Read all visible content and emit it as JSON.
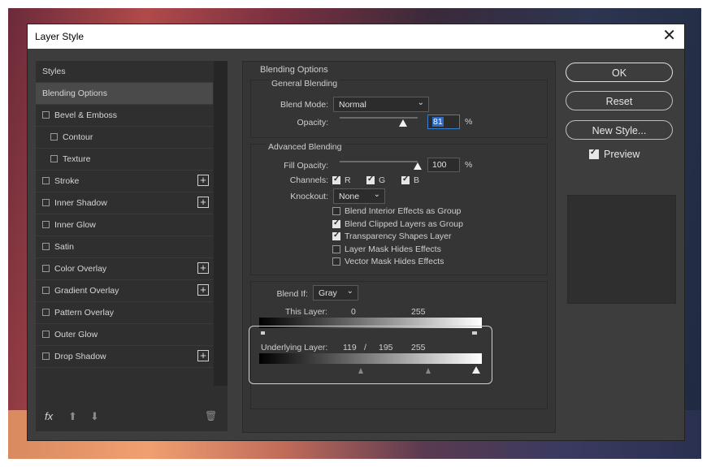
{
  "window": {
    "title": "Layer Style",
    "close_glyph": "✕"
  },
  "sidebar": {
    "items": [
      {
        "label": "Styles",
        "checkbox": false,
        "plus": false,
        "indent": 0,
        "active": false
      },
      {
        "label": "Blending Options",
        "checkbox": false,
        "plus": false,
        "indent": 0,
        "active": true
      },
      {
        "label": "Bevel & Emboss",
        "checkbox": true,
        "plus": false,
        "indent": 0
      },
      {
        "label": "Contour",
        "checkbox": true,
        "plus": false,
        "indent": 1
      },
      {
        "label": "Texture",
        "checkbox": true,
        "plus": false,
        "indent": 1
      },
      {
        "label": "Stroke",
        "checkbox": true,
        "plus": true,
        "indent": 0
      },
      {
        "label": "Inner Shadow",
        "checkbox": true,
        "plus": true,
        "indent": 0
      },
      {
        "label": "Inner Glow",
        "checkbox": true,
        "plus": false,
        "indent": 0
      },
      {
        "label": "Satin",
        "checkbox": true,
        "plus": false,
        "indent": 0
      },
      {
        "label": "Color Overlay",
        "checkbox": true,
        "plus": true,
        "indent": 0
      },
      {
        "label": "Gradient Overlay",
        "checkbox": true,
        "plus": true,
        "indent": 0
      },
      {
        "label": "Pattern Overlay",
        "checkbox": true,
        "plus": false,
        "indent": 0
      },
      {
        "label": "Outer Glow",
        "checkbox": true,
        "plus": false,
        "indent": 0
      },
      {
        "label": "Drop Shadow",
        "checkbox": true,
        "plus": true,
        "indent": 0
      }
    ],
    "footer": {
      "fx": "fx",
      "up": "⬆",
      "down": "⬇",
      "trash": "🗑"
    },
    "plus_glyph": "+"
  },
  "blending": {
    "heading": "Blending Options",
    "general": {
      "heading": "General Blending",
      "mode_label": "Blend Mode:",
      "mode_value": "Normal",
      "opacity_label": "Opacity:",
      "opacity_value": "81",
      "opacity_pct": 0.81,
      "percent": "%"
    },
    "advanced": {
      "heading": "Advanced Blending",
      "fill_label": "Fill Opacity:",
      "fill_value": "100",
      "fill_pct": 1.0,
      "percent": "%",
      "channels_label": "Channels:",
      "channels": [
        {
          "label": "R",
          "checked": true
        },
        {
          "label": "G",
          "checked": true
        },
        {
          "label": "B",
          "checked": true
        }
      ],
      "knockout_label": "Knockout:",
      "knockout_value": "None",
      "options": [
        {
          "label": "Blend Interior Effects as Group",
          "checked": false
        },
        {
          "label": "Blend Clipped Layers as Group",
          "checked": true
        },
        {
          "label": "Transparency Shapes Layer",
          "checked": true
        },
        {
          "label": "Layer Mask Hides Effects",
          "checked": false
        },
        {
          "label": "Vector Mask Hides Effects",
          "checked": false
        }
      ]
    },
    "blendif": {
      "label": "Blend If:",
      "value": "Gray",
      "this_layer_label": "This Layer:",
      "this_low": "0",
      "this_high": "255",
      "underlying_label": "Underlying Layer:",
      "under_low": "119",
      "under_sep": "/",
      "under_mid": "195",
      "under_high": "255"
    }
  },
  "buttons": {
    "ok": "OK",
    "reset": "Reset",
    "new_style": "New Style...",
    "preview": "Preview",
    "preview_checked": true
  }
}
